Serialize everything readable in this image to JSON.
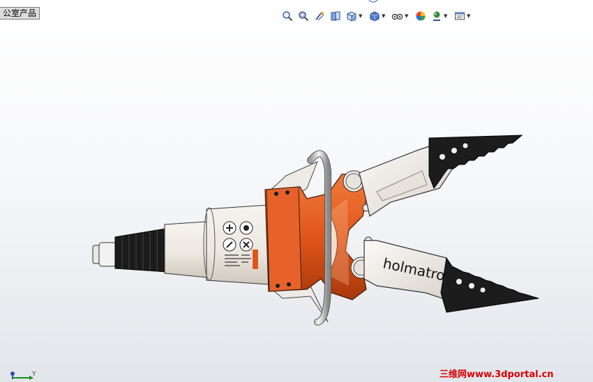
{
  "document_tab": {
    "label": "公室产品"
  },
  "heads_up_toolbar": {
    "buttons": [
      {
        "icon": "zoom-to-fit-icon"
      },
      {
        "icon": "zoom-to-area-icon"
      },
      {
        "icon": "previous-view-icon"
      },
      {
        "icon": "section-view-icon"
      },
      {
        "icon": "view-orientation-icon",
        "dropdown": true
      },
      {
        "icon": "display-style-icon",
        "dropdown": true
      },
      {
        "icon": "hide-show-items-icon",
        "dropdown": true
      },
      {
        "icon": "edit-appearance-icon"
      },
      {
        "icon": "apply-scene-icon",
        "dropdown": true
      },
      {
        "icon": "view-settings-icon",
        "dropdown": true
      }
    ]
  },
  "model": {
    "brand_text": "holmatro",
    "body_color": "#e0561a",
    "blade_color": "#1c1c1c"
  },
  "triad": {
    "axis_label": "Y"
  },
  "watermark": {
    "text": "三维网www.3dportal.cn"
  }
}
